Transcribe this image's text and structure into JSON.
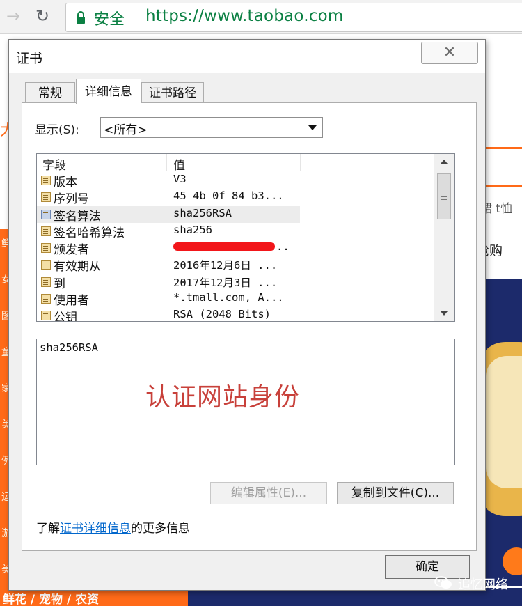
{
  "browser": {
    "secure_label": "安全",
    "url": "https://www.taobao.com"
  },
  "background_page": {
    "left_strip_chars": [
      "鲜",
      "女",
      "图",
      "童",
      "家",
      "美",
      "例",
      "运",
      "游",
      "美"
    ],
    "top_left_char": "大",
    "menu_text": "鲜花 / 宠物 / 农资",
    "right_text_1": "裙 t恤",
    "right_text_2": "抢购",
    "accent_color": "#ff6a18"
  },
  "dialog": {
    "title": "证书",
    "tabs": [
      "常规",
      "详细信息",
      "证书路径"
    ],
    "show_label": "显示(S):",
    "show_value": "<所有>",
    "columns": {
      "field": "字段",
      "value": "值"
    },
    "rows": [
      {
        "field": "版本",
        "value": "V3",
        "icon": "cert-field-icon"
      },
      {
        "field": "序列号",
        "value": "45 4b 0f 84 b3...",
        "icon": "cert-field-icon"
      },
      {
        "field": "签名算法",
        "value": "sha256RSA",
        "icon": "cert-field-icon",
        "selected": true
      },
      {
        "field": "签名哈希算法",
        "value": "sha256",
        "icon": "cert-field-icon"
      },
      {
        "field": "颁发者",
        "value": "..",
        "icon": "cert-field-icon",
        "redacted": true
      },
      {
        "field": "有效期从",
        "value": "2016年12月6日 ...",
        "icon": "cert-field-icon"
      },
      {
        "field": "到",
        "value": "2017年12月3日 ...",
        "icon": "cert-field-icon"
      },
      {
        "field": "使用者",
        "value": "*.tmall.com, A...",
        "icon": "cert-field-icon"
      },
      {
        "field": "公钥",
        "value": "RSA (2048 Bits)",
        "icon": "cert-field-icon"
      }
    ],
    "value_detail": "sha256RSA",
    "overlay_caption": "认证网站身份",
    "edit_button": "编辑属性(E)...",
    "copy_button": "复制到文件(C)...",
    "learn_prefix": "了解",
    "learn_link": "证书详细信息",
    "learn_suffix": "的更多信息",
    "ok_button": "确定"
  },
  "watermark": {
    "text": "追忆网络"
  }
}
